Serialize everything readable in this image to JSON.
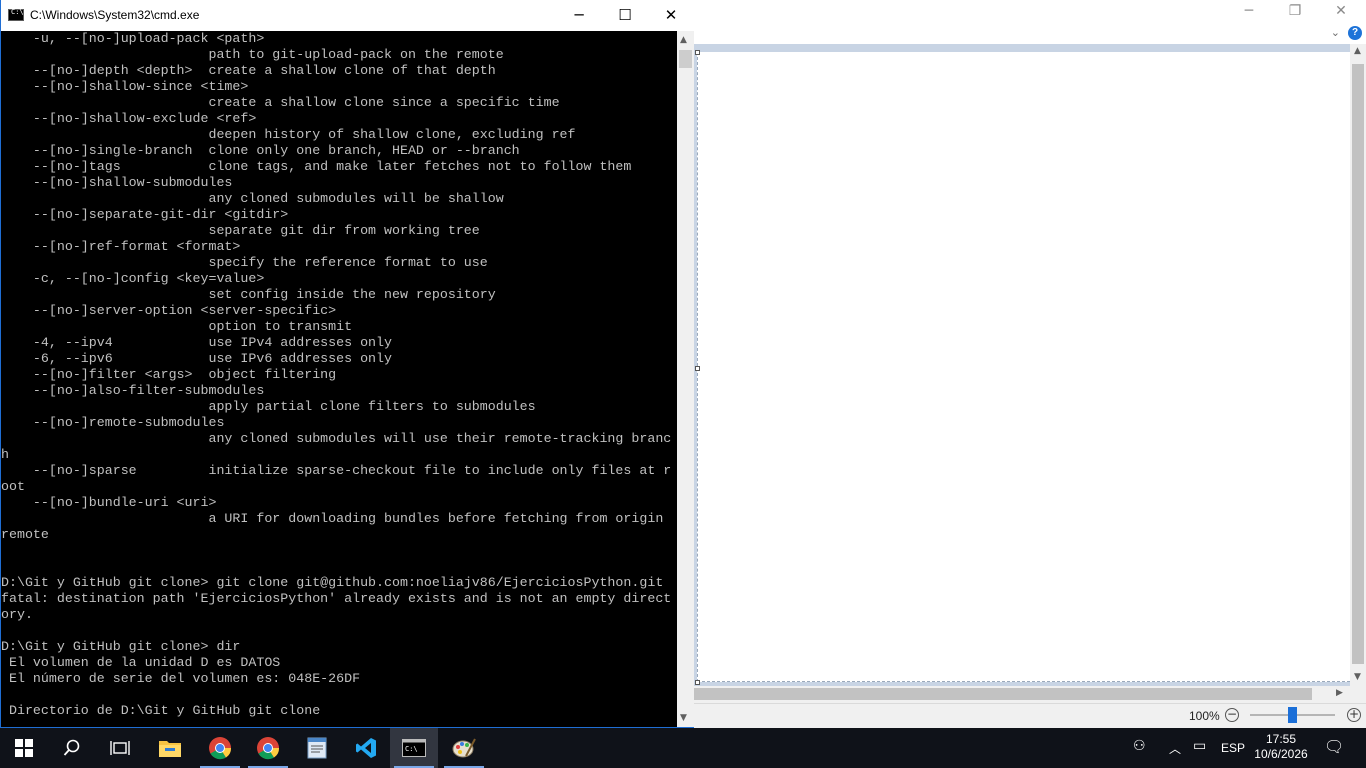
{
  "cmd": {
    "title": "C:\\Windows\\System32\\cmd.exe",
    "output": "    -u, --[no-]upload-pack <path>\n                          path to git-upload-pack on the remote\n    --[no-]depth <depth>  create a shallow clone of that depth\n    --[no-]shallow-since <time>\n                          create a shallow clone since a specific time\n    --[no-]shallow-exclude <ref>\n                          deepen history of shallow clone, excluding ref\n    --[no-]single-branch  clone only one branch, HEAD or --branch\n    --[no-]tags           clone tags, and make later fetches not to follow them\n    --[no-]shallow-submodules\n                          any cloned submodules will be shallow\n    --[no-]separate-git-dir <gitdir>\n                          separate git dir from working tree\n    --[no-]ref-format <format>\n                          specify the reference format to use\n    -c, --[no-]config <key=value>\n                          set config inside the new repository\n    --[no-]server-option <server-specific>\n                          option to transmit\n    -4, --ipv4            use IPv4 addresses only\n    -6, --ipv6            use IPv6 addresses only\n    --[no-]filter <args>  object filtering\n    --[no-]also-filter-submodules\n                          apply partial clone filters to submodules\n    --[no-]remote-submodules\n                          any cloned submodules will use their remote-tracking branc\nh\n    --[no-]sparse         initialize sparse-checkout file to include only files at r\noot\n    --[no-]bundle-uri <uri>\n                          a URI for downloading bundles before fetching from origin\nremote\n\n\nD:\\Git y GitHub git clone> git clone git@github.com:noeliajv86/EjerciciosPython.git\nfatal: destination path 'EjerciciosPython' already exists and is not an empty direct\nory.\n\nD:\\Git y GitHub git clone> dir\n El volumen de la unidad D es DATOS\n El número de serie del volumen es: 048E-26DF\n\n Directorio de D:\\Git y GitHub git clone"
  },
  "paint": {
    "zoom": "100%"
  },
  "taskbar": {
    "apps": [
      "start",
      "search",
      "task-view",
      "file-explorer",
      "chrome",
      "chrome",
      "notepad",
      "vscode",
      "cmd",
      "paint"
    ],
    "language": "ESP",
    "time": "17:55",
    "date": "10/6/2026"
  },
  "colors": {
    "console_bg": "#000000",
    "console_text": "#c0c0c0",
    "taskbar_bg": "#0f1219",
    "accent": "#1b6fd8"
  }
}
